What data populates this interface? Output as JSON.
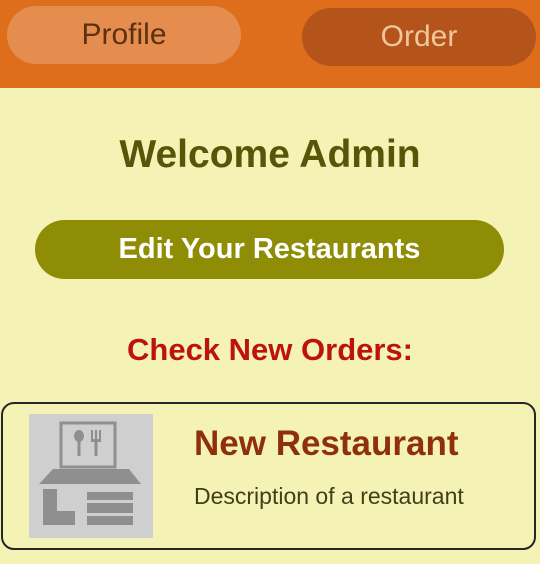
{
  "tabs": {
    "profile_label": "Profile",
    "order_label": "Order"
  },
  "main": {
    "welcome": "Welcome Admin",
    "edit_button_label": "Edit Your Restaurants",
    "check_orders_heading": "Check New Orders:"
  },
  "restaurants": [
    {
      "name": "New Restaurant",
      "description": "Description of a restaurant",
      "icon": "restaurant-storefront-icon"
    }
  ],
  "colors": {
    "topbar": "#de6e1c",
    "background": "#f4f2b4",
    "accent": "#8f8d05",
    "heading_red": "#bd1310",
    "restaurant_name": "#8f300d"
  }
}
